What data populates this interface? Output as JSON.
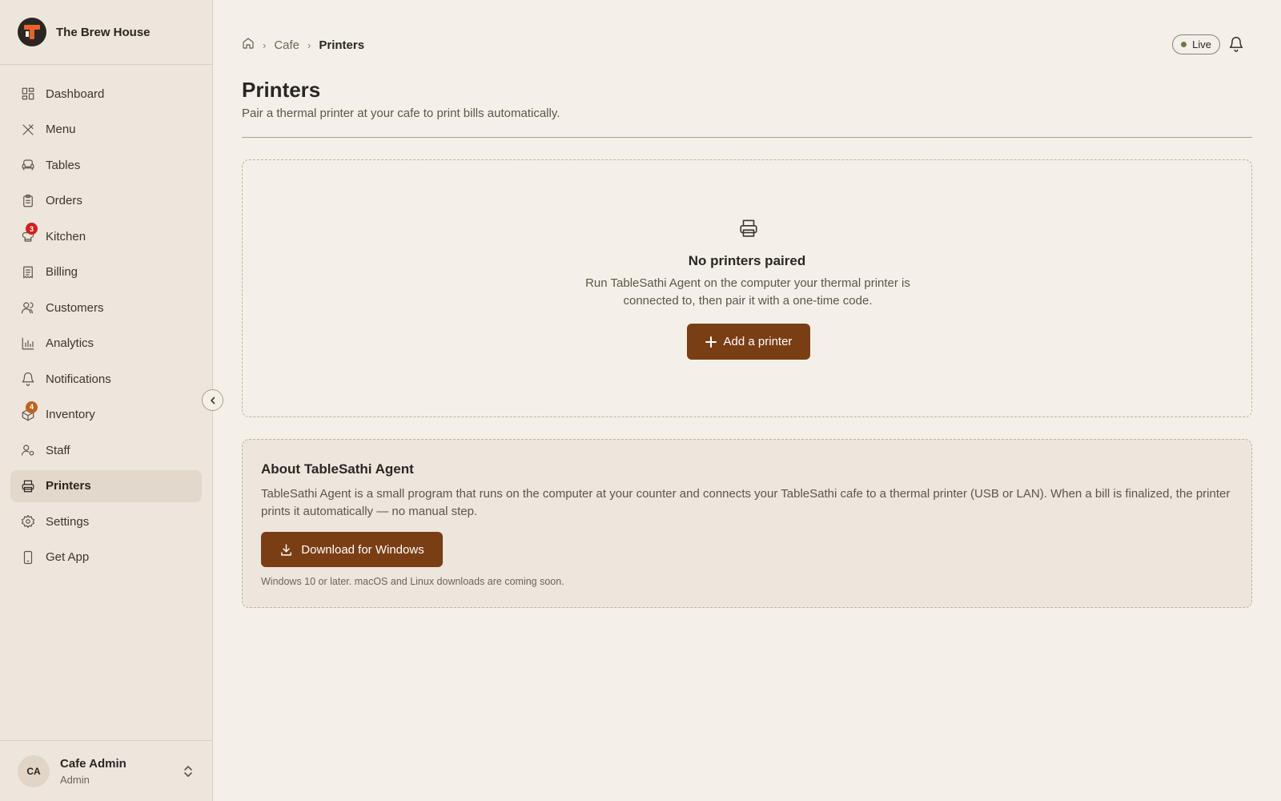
{
  "brand": {
    "name": "The Brew House"
  },
  "sidebar": {
    "items": [
      {
        "label": "Dashboard",
        "icon": "dashboard-icon"
      },
      {
        "label": "Menu",
        "icon": "utensils-icon"
      },
      {
        "label": "Tables",
        "icon": "armchair-icon"
      },
      {
        "label": "Orders",
        "icon": "clipboard-icon"
      },
      {
        "label": "Kitchen",
        "icon": "chef-hat-icon",
        "badge": "3",
        "badge_color": "#d11f1f"
      },
      {
        "label": "Billing",
        "icon": "receipt-icon"
      },
      {
        "label": "Customers",
        "icon": "users-icon"
      },
      {
        "label": "Analytics",
        "icon": "bar-chart-icon"
      },
      {
        "label": "Notifications",
        "icon": "bell-icon"
      },
      {
        "label": "Inventory",
        "icon": "package-icon",
        "badge": "4",
        "badge_color": "#c2621b"
      },
      {
        "label": "Staff",
        "icon": "user-cog-icon"
      },
      {
        "label": "Printers",
        "icon": "printer-icon",
        "active": true
      },
      {
        "label": "Settings",
        "icon": "gear-icon"
      },
      {
        "label": "Get App",
        "icon": "smartphone-icon"
      }
    ]
  },
  "user": {
    "initials": "CA",
    "name": "Cafe Admin",
    "role": "Admin"
  },
  "breadcrumb": {
    "items": [
      "Cafe",
      "Printers"
    ]
  },
  "status": {
    "label": "Live",
    "color": "#6b7a4a"
  },
  "page": {
    "title": "Printers",
    "subtitle": "Pair a thermal printer at your cafe to print bills automatically."
  },
  "empty_state": {
    "title": "No printers paired",
    "description": "Run TableSathi Agent on the computer your thermal printer is connected to, then pair it with a one-time code.",
    "button_label": "Add a printer"
  },
  "about": {
    "title": "About TableSathi Agent",
    "description": "TableSathi Agent is a small program that runs on the computer at your counter and connects your TableSathi cafe to a thermal printer (USB or LAN). When a bill is finalized, the printer prints it automatically — no manual step.",
    "download_label": "Download for Windows",
    "note": "Windows 10 or later. macOS and Linux downloads are coming soon."
  },
  "colors": {
    "accent": "#7a3e14",
    "background": "#f4f0e8",
    "sidebar": "#ede6dc"
  }
}
